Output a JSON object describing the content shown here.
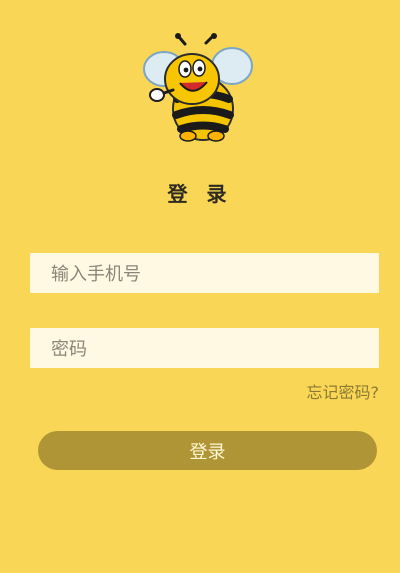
{
  "app": {
    "title": "登 录"
  },
  "form": {
    "phone_placeholder": "输入手机号",
    "password_placeholder": "密码",
    "forgot_password": "忘记密码?",
    "submit_label": "登录"
  },
  "logo": {
    "icon": "bee-icon"
  },
  "colors": {
    "background": "#F9D655",
    "input_background": "#FFF9E3",
    "button_background": "#AF9535",
    "link_color": "#8C7A34"
  }
}
